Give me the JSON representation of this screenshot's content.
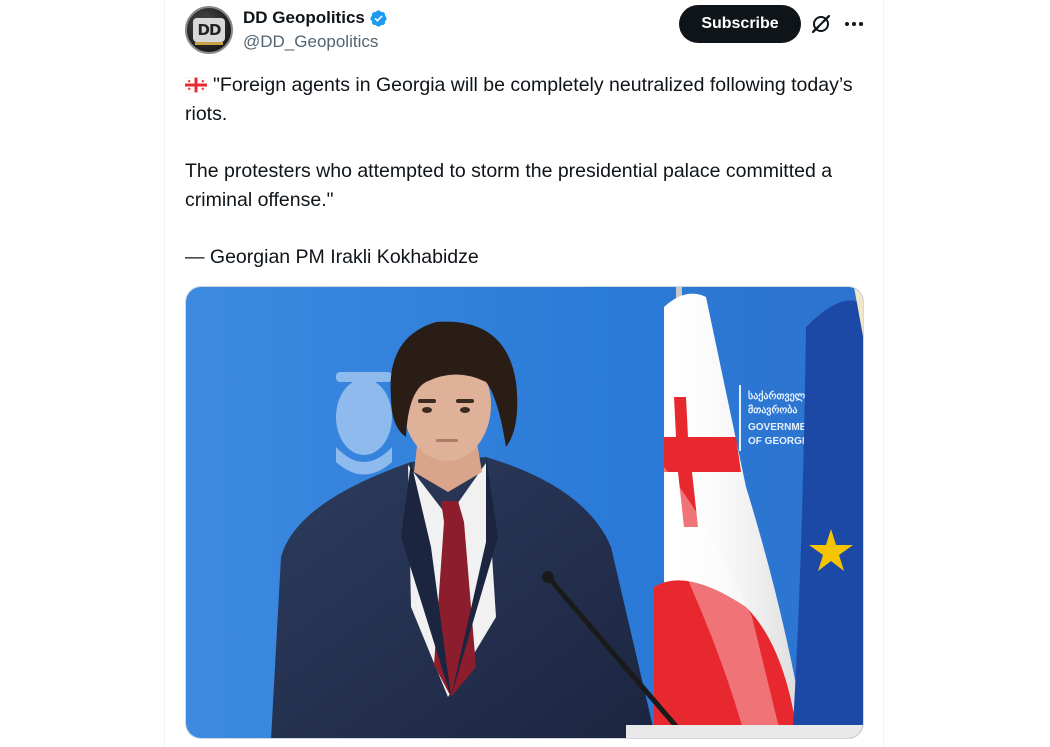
{
  "post": {
    "author": {
      "display_name": "DD Geopolitics",
      "handle": "@DD_Geopolitics",
      "avatar_text": "DD",
      "verified": true,
      "verified_color": "#1d9bf0"
    },
    "actions": {
      "subscribe_label": "Subscribe",
      "grok_icon": "grok-icon",
      "more_icon": "more-options-icon"
    },
    "text": {
      "flag_emoji": "georgia-flag",
      "line1": "\"Foreign agents in Georgia will be completely neutralized following today’s riots.",
      "line2": "The protesters who attempted to storm the presidential palace committed a criminal offense.\"",
      "line3": "— Georgian PM Irakli Kokhabidze"
    },
    "media": {
      "backdrop_lines": [
        "საქართველო",
        "მთავრობა",
        "GOVERNMENT",
        "OF GEORGIA"
      ],
      "colors": {
        "backdrop": "#2f7fd8",
        "flag_red": "#e8282f",
        "eu_blue": "#1d49a6",
        "eu_star": "#f6c400",
        "suit": "#24324f",
        "tie": "#8b1d2c"
      }
    }
  }
}
